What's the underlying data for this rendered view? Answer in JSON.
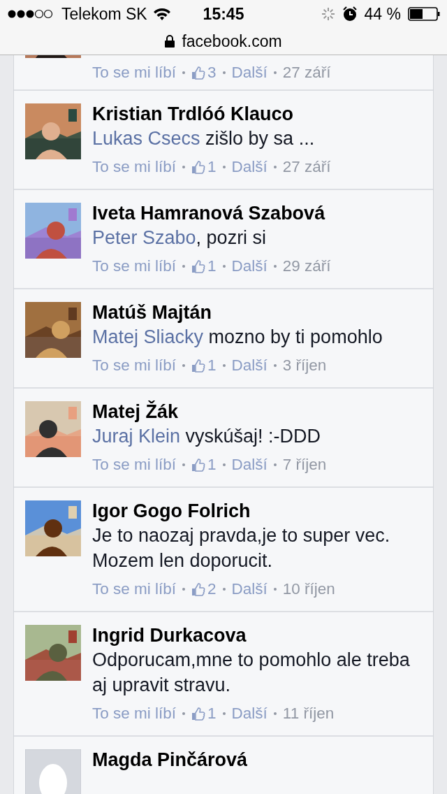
{
  "status_bar": {
    "carrier": "Telekom SK",
    "time": "15:45",
    "battery": "44 %"
  },
  "address_bar": {
    "url": "facebook.com"
  },
  "comments": [
    {
      "kind": "partial",
      "actions": {
        "like": "To se mi líbí",
        "count": "3",
        "more": "Další",
        "date": "27 září"
      }
    },
    {
      "kind": "full",
      "name": "Kristian Trdlóó Klauco",
      "mention": "Lukas Csecs",
      "text": " zišlo by sa ...",
      "actions": {
        "like": "To se mi líbí",
        "count": "1",
        "more": "Další",
        "date": "27 září"
      }
    },
    {
      "kind": "full",
      "name": "Iveta Hamranová Szabová",
      "mention": "Peter Szabo",
      "text": ", pozri si",
      "actions": {
        "like": "To se mi líbí",
        "count": "1",
        "more": "Další",
        "date": "29 září"
      }
    },
    {
      "kind": "full",
      "name": "Matúš Majtán",
      "mention": "Matej Sliacky",
      "text": " mozno by ti pomohlo",
      "actions": {
        "like": "To se mi líbí",
        "count": "1",
        "more": "Další",
        "date": "3 říjen"
      }
    },
    {
      "kind": "full",
      "name": "Matej Žák",
      "mention": "Juraj Klein",
      "text": " vyskúšaj! :-DDD",
      "actions": {
        "like": "To se mi líbí",
        "count": "1",
        "more": "Další",
        "date": "7 říjen"
      }
    },
    {
      "kind": "full",
      "name": "Igor Gogo Folrich",
      "text": "Je to naozaj pravda,je to super vec. Mozem len doporucit.",
      "actions": {
        "like": "To se mi líbí",
        "count": "2",
        "more": "Další",
        "date": "10 říjen"
      }
    },
    {
      "kind": "full",
      "name": "Ingrid Durkacova",
      "text": "Odporucam,mne to pomohlo ale treba aj upravit stravu.",
      "actions": {
        "like": "To se mi líbí",
        "count": "1",
        "more": "Další",
        "date": "11 říjen"
      }
    },
    {
      "kind": "full",
      "avatar": {
        "kind": "silhouette"
      },
      "name": "Magda Pinčárová"
    }
  ]
}
